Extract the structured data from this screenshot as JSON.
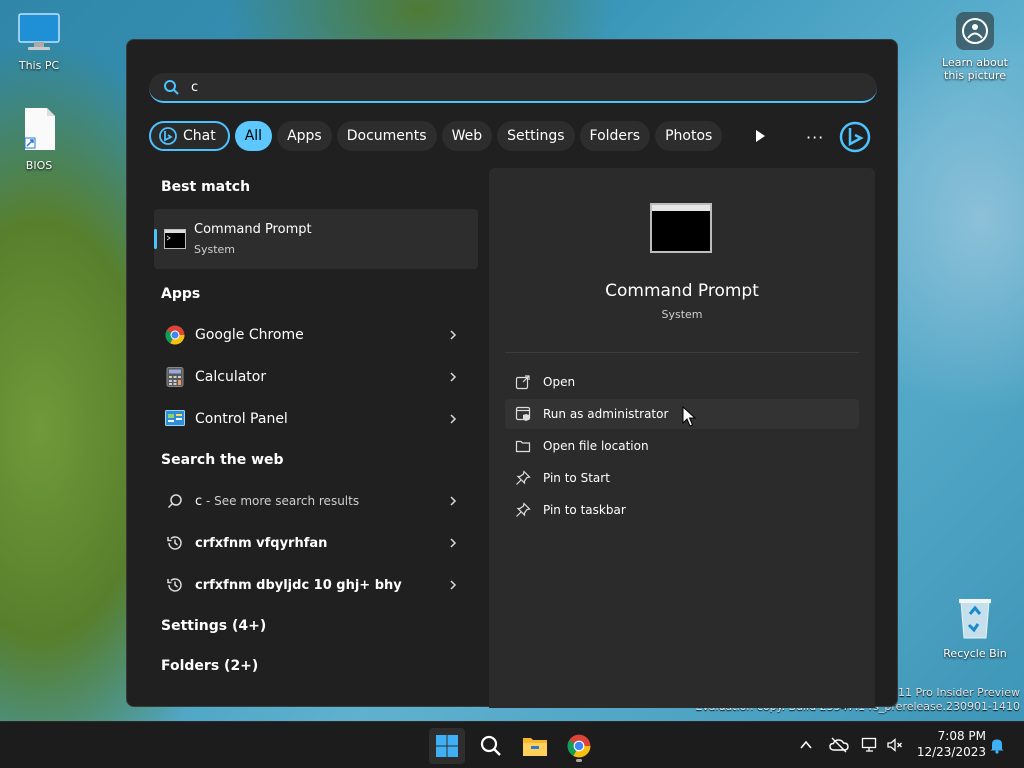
{
  "desktop": {
    "this_pc_label": "This PC",
    "bios_label": "BIOS",
    "recycle_bin_label": "Recycle Bin",
    "learn_label": "Learn about this picture",
    "watermark_line1": "11 Pro Insider Preview",
    "watermark_line2": "Evaluation copy. Build 23547.1 rs_prerelease.230901-1410"
  },
  "search": {
    "query": "c",
    "filters": [
      "All",
      "Apps",
      "Documents",
      "Web",
      "Settings",
      "Folders",
      "Photos"
    ],
    "chat_label": "Chat",
    "more_label": "···"
  },
  "results": {
    "best_match_header": "Best match",
    "best_match": {
      "title": "Command Prompt",
      "subtitle": "System"
    },
    "apps_header": "Apps",
    "apps": [
      "Google Chrome",
      "Calculator",
      "Control Panel"
    ],
    "web_header": "Search the web",
    "web_first_query": "c",
    "web_first_suffix": " - See more search results",
    "web_history": [
      "crfxfnm vfqyrhfan",
      "crfxfnm dbyljdc 10 ghj+ bhy"
    ],
    "settings_header": "Settings (4+)",
    "folders_header": "Folders (2+)"
  },
  "preview": {
    "title": "Command Prompt",
    "subtitle": "System",
    "actions": [
      "Open",
      "Run as administrator",
      "Open file location",
      "Pin to Start",
      "Pin to taskbar"
    ]
  },
  "taskbar": {
    "time": "7:08 PM",
    "date": "12/23/2023"
  },
  "colors": {
    "accent": "#4cc2ff",
    "panel_bg": "#202020",
    "pane_bg": "#2b2b2b"
  }
}
